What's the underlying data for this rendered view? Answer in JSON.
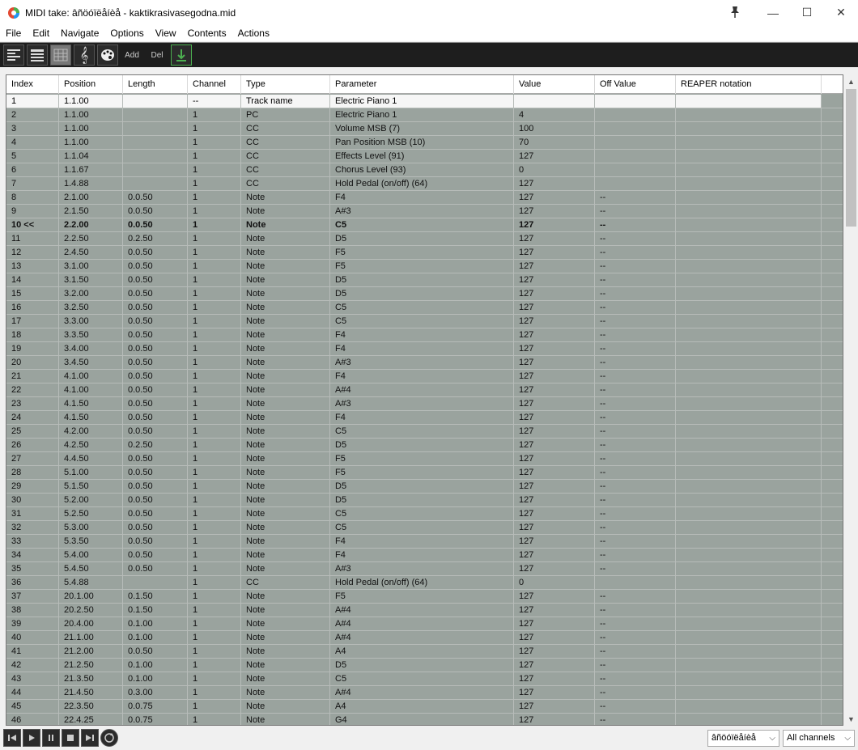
{
  "window": {
    "title": "MIDI take: âñöóïëåíèå - kaktikrasivasegodna.mid",
    "minimize": "—",
    "maximize": "☐",
    "close": "✕"
  },
  "menu": [
    "File",
    "Edit",
    "Navigate",
    "Options",
    "View",
    "Contents",
    "Actions"
  ],
  "toolbar": {
    "add_label": "Add",
    "del_label": "Del"
  },
  "columns": [
    "Index",
    "Position",
    "Length",
    "Channel",
    "Type",
    "Parameter",
    "Value",
    "Off Value",
    "REAPER notation"
  ],
  "rows": [
    [
      "1",
      "1.1.00",
      "",
      "--",
      "Track name",
      "Electric Piano 1",
      "",
      "",
      ""
    ],
    [
      "2",
      "1.1.00",
      "",
      "1",
      "PC",
      "Electric Piano 1",
      "4",
      "",
      ""
    ],
    [
      "3",
      "1.1.00",
      "",
      "1",
      "CC",
      "Volume MSB (7)",
      "100",
      "",
      ""
    ],
    [
      "4",
      "1.1.00",
      "",
      "1",
      "CC",
      "Pan Position MSB (10)",
      "70",
      "",
      ""
    ],
    [
      "5",
      "1.1.04",
      "",
      "1",
      "CC",
      "Effects Level (91)",
      "127",
      "",
      ""
    ],
    [
      "6",
      "1.1.67",
      "",
      "1",
      "CC",
      "Chorus Level (93)",
      "0",
      "",
      ""
    ],
    [
      "7",
      "1.4.88",
      "",
      "1",
      "CC",
      "Hold Pedal (on/off) (64)",
      "127",
      "",
      ""
    ],
    [
      "8",
      "2.1.00",
      "0.0.50",
      "1",
      "Note",
      "F4",
      "127",
      "--",
      ""
    ],
    [
      "9",
      "2.1.50",
      "0.0.50",
      "1",
      "Note",
      "A#3",
      "127",
      "--",
      ""
    ],
    [
      "10 <<",
      "2.2.00",
      "0.0.50",
      "1",
      "Note",
      "C5",
      "127",
      "--",
      ""
    ],
    [
      "11",
      "2.2.50",
      "0.2.50",
      "1",
      "Note",
      "D5",
      "127",
      "--",
      ""
    ],
    [
      "12",
      "2.4.50",
      "0.0.50",
      "1",
      "Note",
      "F5",
      "127",
      "--",
      ""
    ],
    [
      "13",
      "3.1.00",
      "0.0.50",
      "1",
      "Note",
      "F5",
      "127",
      "--",
      ""
    ],
    [
      "14",
      "3.1.50",
      "0.0.50",
      "1",
      "Note",
      "D5",
      "127",
      "--",
      ""
    ],
    [
      "15",
      "3.2.00",
      "0.0.50",
      "1",
      "Note",
      "D5",
      "127",
      "--",
      ""
    ],
    [
      "16",
      "3.2.50",
      "0.0.50",
      "1",
      "Note",
      "C5",
      "127",
      "--",
      ""
    ],
    [
      "17",
      "3.3.00",
      "0.0.50",
      "1",
      "Note",
      "C5",
      "127",
      "--",
      ""
    ],
    [
      "18",
      "3.3.50",
      "0.0.50",
      "1",
      "Note",
      "F4",
      "127",
      "--",
      ""
    ],
    [
      "19",
      "3.4.00",
      "0.0.50",
      "1",
      "Note",
      "F4",
      "127",
      "--",
      ""
    ],
    [
      "20",
      "3.4.50",
      "0.0.50",
      "1",
      "Note",
      "A#3",
      "127",
      "--",
      ""
    ],
    [
      "21",
      "4.1.00",
      "0.0.50",
      "1",
      "Note",
      "F4",
      "127",
      "--",
      ""
    ],
    [
      "22",
      "4.1.00",
      "0.0.50",
      "1",
      "Note",
      "A#4",
      "127",
      "--",
      ""
    ],
    [
      "23",
      "4.1.50",
      "0.0.50",
      "1",
      "Note",
      "A#3",
      "127",
      "--",
      ""
    ],
    [
      "24",
      "4.1.50",
      "0.0.50",
      "1",
      "Note",
      "F4",
      "127",
      "--",
      ""
    ],
    [
      "25",
      "4.2.00",
      "0.0.50",
      "1",
      "Note",
      "C5",
      "127",
      "--",
      ""
    ],
    [
      "26",
      "4.2.50",
      "0.2.50",
      "1",
      "Note",
      "D5",
      "127",
      "--",
      ""
    ],
    [
      "27",
      "4.4.50",
      "0.0.50",
      "1",
      "Note",
      "F5",
      "127",
      "--",
      ""
    ],
    [
      "28",
      "5.1.00",
      "0.0.50",
      "1",
      "Note",
      "F5",
      "127",
      "--",
      ""
    ],
    [
      "29",
      "5.1.50",
      "0.0.50",
      "1",
      "Note",
      "D5",
      "127",
      "--",
      ""
    ],
    [
      "30",
      "5.2.00",
      "0.0.50",
      "1",
      "Note",
      "D5",
      "127",
      "--",
      ""
    ],
    [
      "31",
      "5.2.50",
      "0.0.50",
      "1",
      "Note",
      "C5",
      "127",
      "--",
      ""
    ],
    [
      "32",
      "5.3.00",
      "0.0.50",
      "1",
      "Note",
      "C5",
      "127",
      "--",
      ""
    ],
    [
      "33",
      "5.3.50",
      "0.0.50",
      "1",
      "Note",
      "F4",
      "127",
      "--",
      ""
    ],
    [
      "34",
      "5.4.00",
      "0.0.50",
      "1",
      "Note",
      "F4",
      "127",
      "--",
      ""
    ],
    [
      "35",
      "5.4.50",
      "0.0.50",
      "1",
      "Note",
      "A#3",
      "127",
      "--",
      ""
    ],
    [
      "36",
      "5.4.88",
      "",
      "1",
      "CC",
      "Hold Pedal (on/off) (64)",
      "0",
      "",
      ""
    ],
    [
      "37",
      "20.1.00",
      "0.1.50",
      "1",
      "Note",
      "F5",
      "127",
      "--",
      ""
    ],
    [
      "38",
      "20.2.50",
      "0.1.50",
      "1",
      "Note",
      "A#4",
      "127",
      "--",
      ""
    ],
    [
      "39",
      "20.4.00",
      "0.1.00",
      "1",
      "Note",
      "A#4",
      "127",
      "--",
      ""
    ],
    [
      "40",
      "21.1.00",
      "0.1.00",
      "1",
      "Note",
      "A#4",
      "127",
      "--",
      ""
    ],
    [
      "41",
      "21.2.00",
      "0.0.50",
      "1",
      "Note",
      "A4",
      "127",
      "--",
      ""
    ],
    [
      "42",
      "21.2.50",
      "0.1.00",
      "1",
      "Note",
      "D5",
      "127",
      "--",
      ""
    ],
    [
      "43",
      "21.3.50",
      "0.1.00",
      "1",
      "Note",
      "C5",
      "127",
      "--",
      ""
    ],
    [
      "44",
      "21.4.50",
      "0.3.00",
      "1",
      "Note",
      "A#4",
      "127",
      "--",
      ""
    ],
    [
      "45",
      "22.3.50",
      "0.0.75",
      "1",
      "Note",
      "A4",
      "127",
      "--",
      ""
    ],
    [
      "46",
      "22.4.25",
      "0.0.75",
      "1",
      "Note",
      "G4",
      "127",
      "--",
      ""
    ]
  ],
  "bold_row": "10 <<",
  "bottom": {
    "track_select": "âñöóïëåíèå",
    "channel_select": "All channels"
  },
  "colors": {
    "grid_bg": "#9aa39e",
    "toolbar_bg": "#1e1e1e"
  }
}
